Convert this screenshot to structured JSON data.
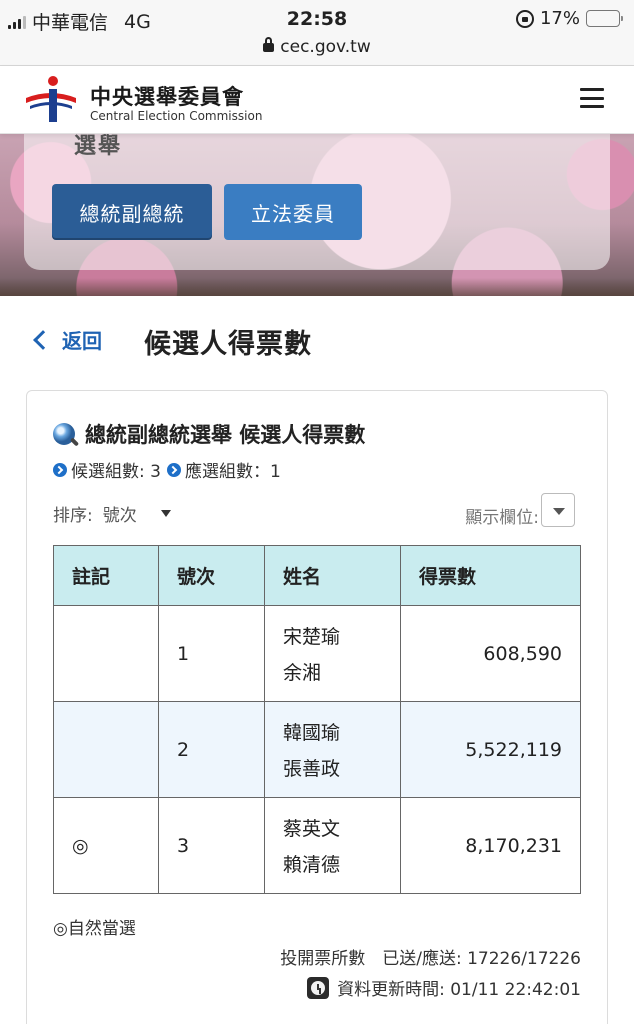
{
  "status_bar": {
    "carrier": "中華電信",
    "network": "4G",
    "time": "22:58",
    "url": "cec.gov.tw",
    "battery_text": "17%",
    "battery_level": 0.17,
    "battery_color": "#ff2a2a"
  },
  "header": {
    "org_name_zh": "中央選舉委員會",
    "org_name_en": "Central Election Commission",
    "menu_icon": "hamburger-menu-icon"
  },
  "banner": {
    "cut_text": "選舉",
    "buttons": [
      {
        "label": "總統副總統",
        "color": "#2b5d96"
      },
      {
        "label": "立法委員",
        "color": "#3a7dc2"
      }
    ]
  },
  "nav": {
    "back_label": "返回",
    "page_title": "候選人得票數"
  },
  "card": {
    "title": "總統副總統選舉 候選人得票數",
    "candidate_groups_label": "候選組數: 3",
    "elected_groups_label": "應選組數：1",
    "sort_label": "排序:",
    "sort_value": "號次",
    "columns_label": "顯示欄位:",
    "table": {
      "headers": [
        "註記",
        "號次",
        "姓名",
        "得票數"
      ],
      "header_color": "#c9ecef",
      "rows": [
        {
          "mark": "",
          "number": "1",
          "name1": "宋楚瑜",
          "name2": "余湘",
          "votes": "608,590"
        },
        {
          "mark": "",
          "number": "2",
          "name1": "韓國瑜",
          "name2": "張善政",
          "votes": "5,522,119"
        },
        {
          "mark": "◎",
          "number": "3",
          "name1": "蔡英文",
          "name2": "賴清德",
          "votes": "8,170,231"
        }
      ]
    },
    "legend_note": "◎自然當選",
    "stations_label": "投開票所數　已送/應送: 17226/17226",
    "update_label": "資料更新時間: 01/11 22:42:01"
  }
}
